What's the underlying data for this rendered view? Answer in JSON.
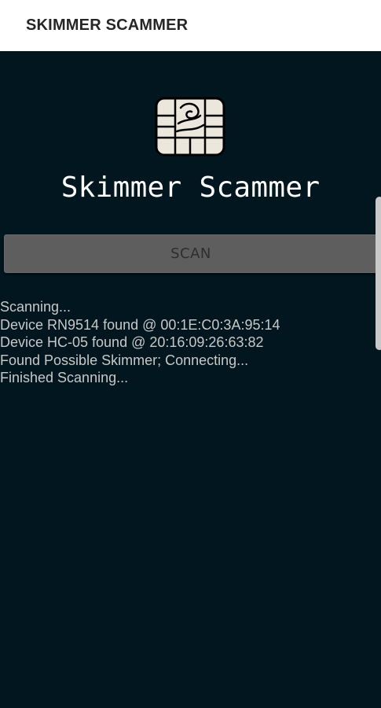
{
  "app_bar": {
    "title": "SKIMMER SCAMMER"
  },
  "header": {
    "logo_icon": "chip-card-icon",
    "app_name": "Skimmer Scammer"
  },
  "scan_button": {
    "label": "SCAN"
  },
  "log": {
    "lines": [
      "Scanning...",
      "Device RN9514 found @ 00:1E:C0:3A:95:14",
      "Device HC-05 found @ 20:16:09:26:63:82",
      "Found Possible Skimmer; Connecting...",
      "Finished Scanning..."
    ]
  },
  "colors": {
    "background": "#01161e",
    "app_bar": "#ffffff",
    "button": "#5e5e5e",
    "log_text": "#c8c8c8",
    "chip_fill": "#ece7dc"
  }
}
